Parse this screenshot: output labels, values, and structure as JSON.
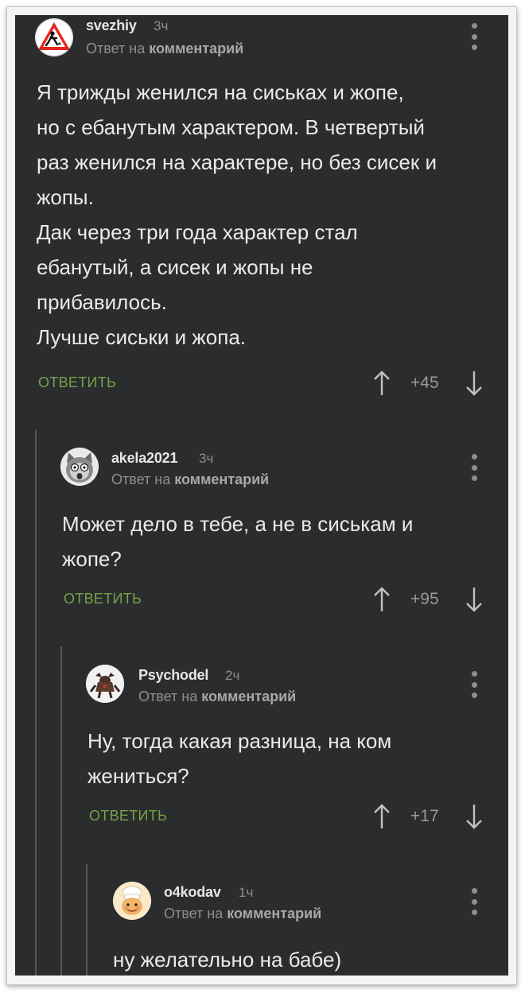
{
  "comments": [
    {
      "author": "svezhiy",
      "time": "3ч",
      "reply_prefix": "Ответ на",
      "reply_target": "комментарий",
      "lines": [
        "Я трижды женился на сиськах и жопе,",
        "но с ебанутым характером. В четвертый",
        "раз женился на характере, но без сисек и",
        "жопы.",
        "Дак через три года характер стал",
        "ебанутый, а сисек и жопы не",
        "прибавилось.",
        "Лучше сиськи и жопа."
      ],
      "reply_label": "ОТВЕТИТЬ",
      "rating": "+45",
      "avatar_icon": "road-work-sign-avatar"
    },
    {
      "author": "akela2021",
      "time": "3ч",
      "reply_prefix": "Ответ на",
      "reply_target": "комментарий",
      "lines": [
        "Может дело в тебе, а не в сиськам и",
        "жопе?"
      ],
      "reply_label": "ОТВЕТИТЬ",
      "rating": "+95",
      "avatar_icon": "shocked-cat-avatar"
    },
    {
      "author": "Psychodel",
      "time": "2ч",
      "reply_prefix": "Ответ на",
      "reply_target": "комментарий",
      "lines": [
        "Ну, тогда какая разница, на ком",
        "жениться?"
      ],
      "reply_label": "ОТВЕТИТЬ",
      "rating": "+17",
      "avatar_icon": "creature-figure-avatar"
    },
    {
      "author": "o4kodav",
      "time": "1ч",
      "reply_prefix": "Ответ на",
      "reply_target": "комментарий",
      "lines": [
        "ну желательно на бабе)"
      ],
      "avatar_icon": "cartoon-chef-avatar"
    }
  ],
  "colors": {
    "panel_background": "#2b2c2e",
    "reply_button": "#74a34a",
    "author": "#e6e6e6",
    "meta": "#8e8e8e",
    "thread_line": "#55585c"
  }
}
